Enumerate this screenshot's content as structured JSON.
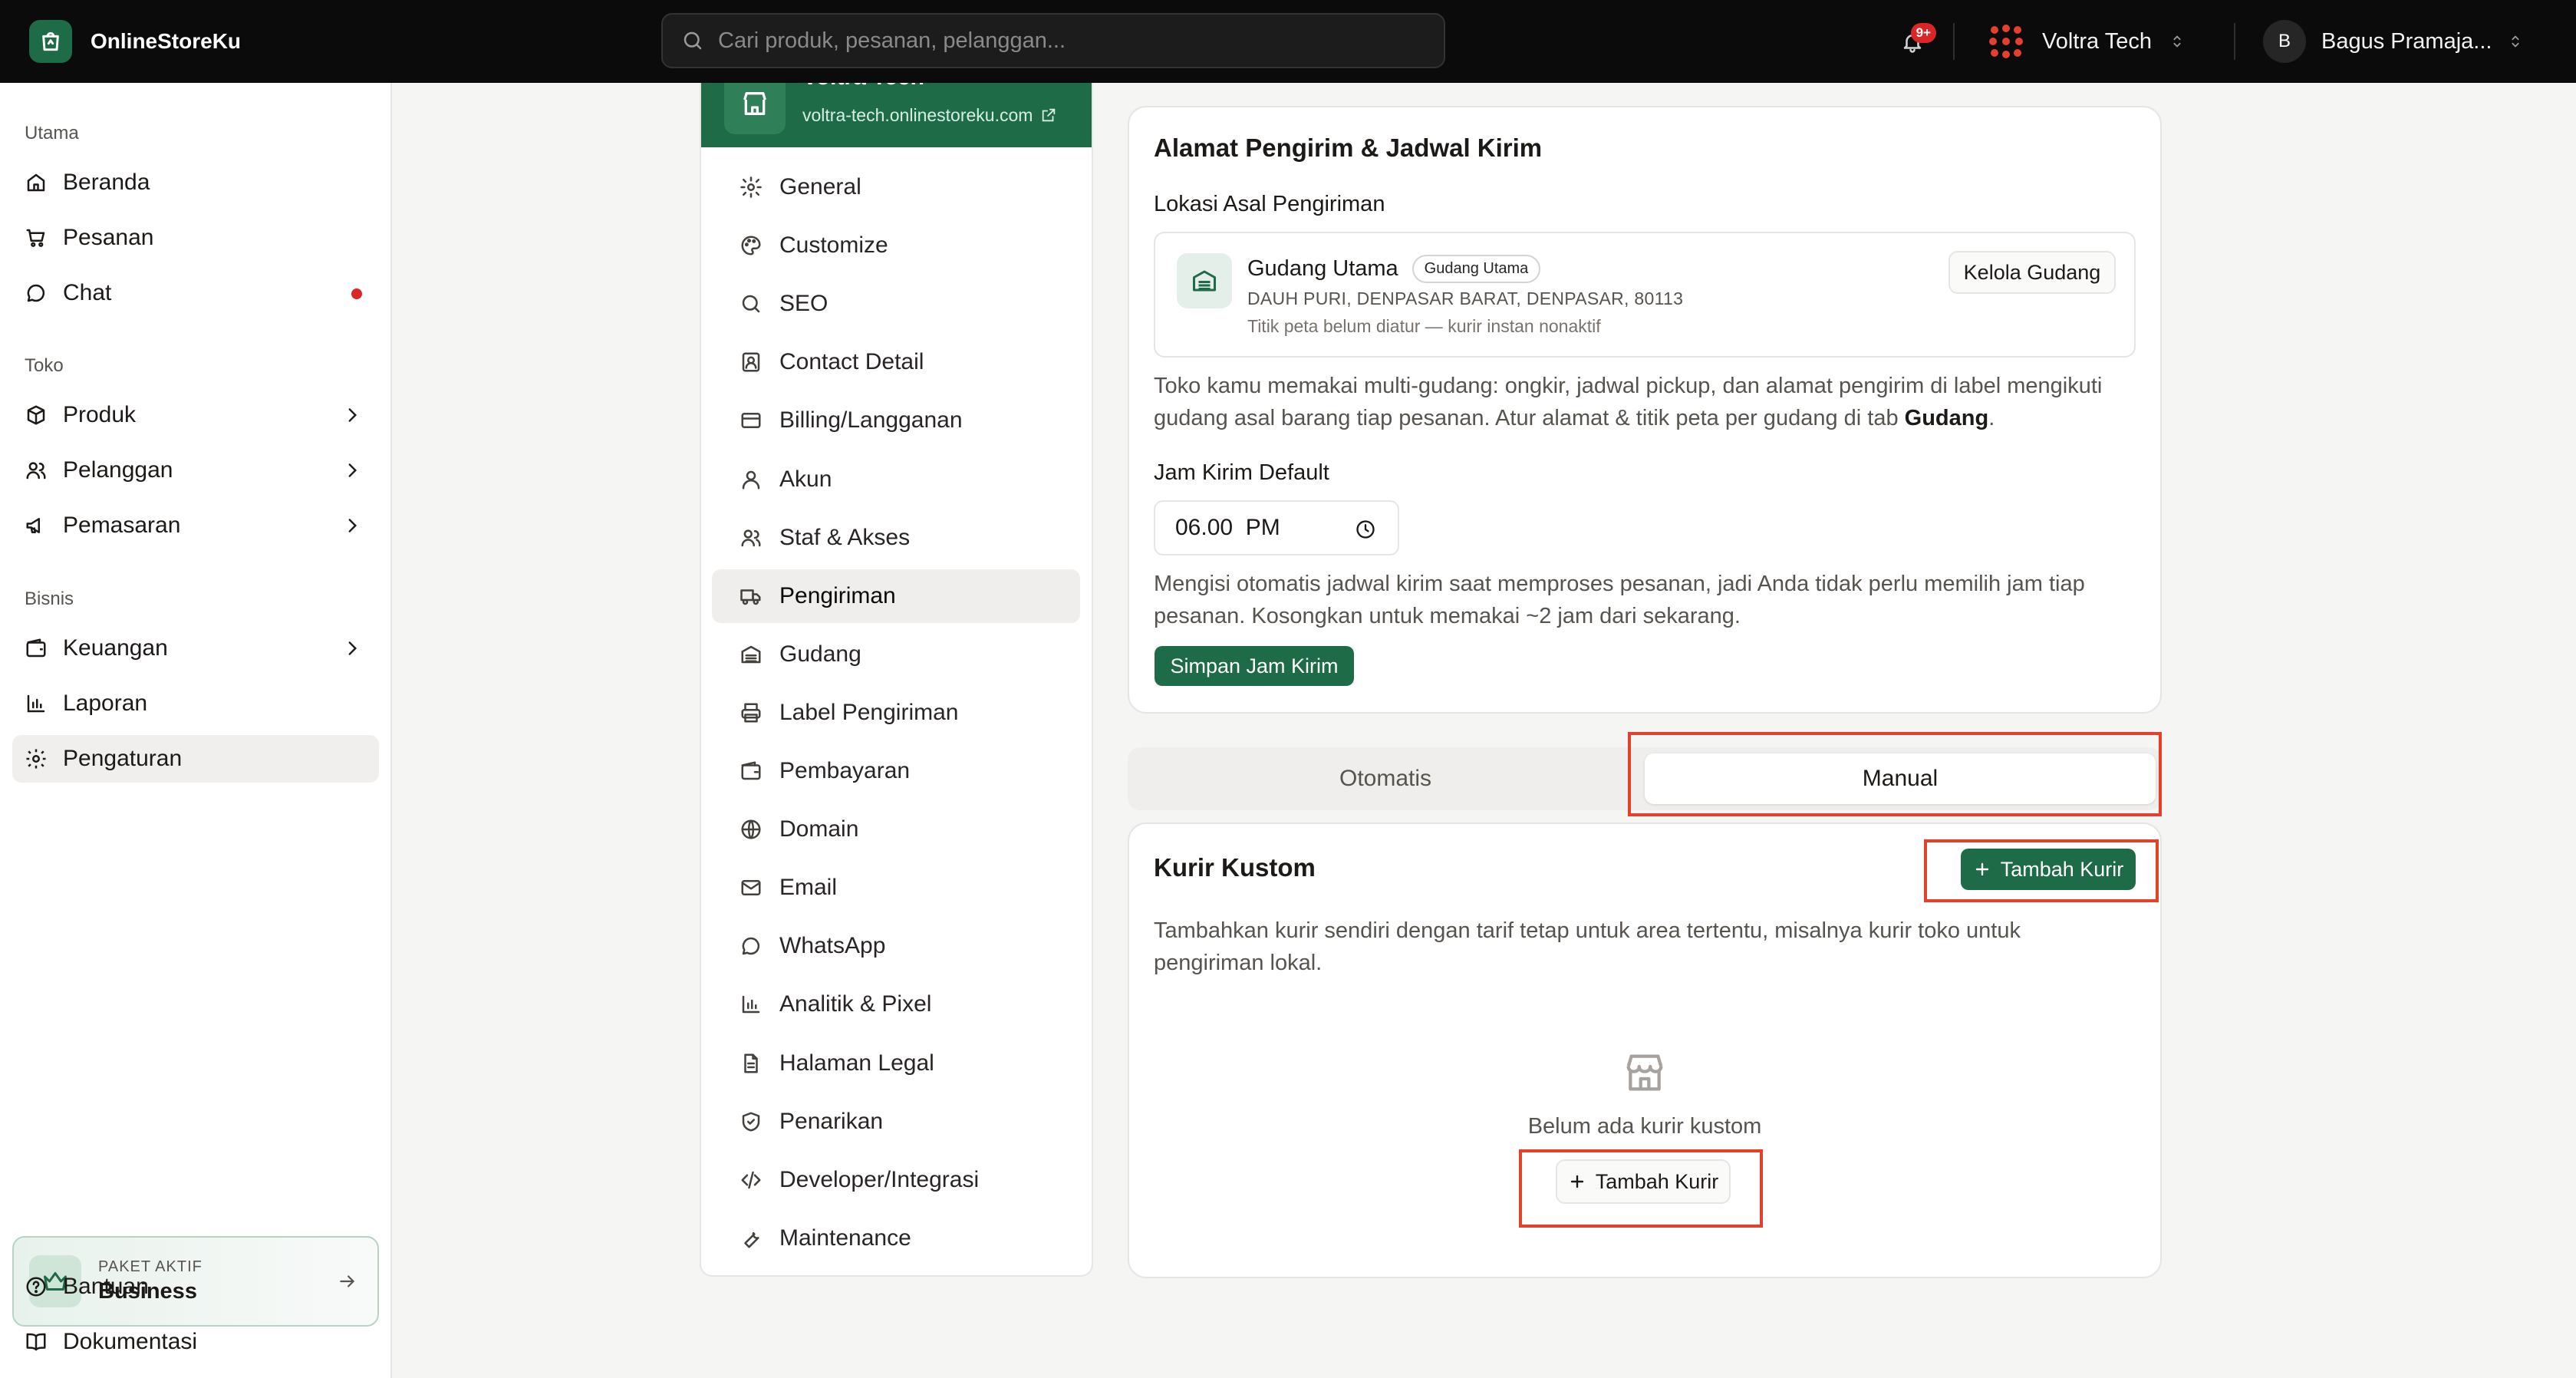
{
  "topbar": {
    "brand": "OnlineStoreKu",
    "search_placeholder": "Cari produk, pesanan, pelanggan...",
    "notification_badge": "9+",
    "store_name": "Voltra Tech",
    "avatar_initial": "B",
    "user_name": "Bagus Pramaja..."
  },
  "sidebar": {
    "groups": [
      {
        "label": "Utama",
        "items": [
          {
            "label": "Beranda",
            "icon": "home-icon"
          },
          {
            "label": "Pesanan",
            "icon": "cart-icon"
          },
          {
            "label": "Chat",
            "icon": "chat-icon",
            "dot": true
          }
        ]
      },
      {
        "label": "Toko",
        "items": [
          {
            "label": "Produk",
            "icon": "box-icon",
            "expandable": true
          },
          {
            "label": "Pelanggan",
            "icon": "users-icon",
            "expandable": true
          },
          {
            "label": "Pemasaran",
            "icon": "megaphone-icon",
            "expandable": true
          }
        ]
      },
      {
        "label": "Bisnis",
        "items": [
          {
            "label": "Keuangan",
            "icon": "wallet-icon",
            "expandable": true
          },
          {
            "label": "Laporan",
            "icon": "chart-icon"
          },
          {
            "label": "Pengaturan",
            "icon": "gear-icon",
            "active": true
          }
        ]
      }
    ],
    "plan": {
      "label": "PAKET AKTIF",
      "name": "Business"
    },
    "footer": [
      {
        "label": "Bantuan",
        "icon": "help-icon"
      },
      {
        "label": "Dokumentasi",
        "icon": "book-icon"
      }
    ]
  },
  "settings_menu": {
    "store_title": "Voltra Tech",
    "store_url": "voltra-tech.onlinestoreku.com",
    "items": [
      {
        "label": "General",
        "icon": "gear-icon"
      },
      {
        "label": "Customize",
        "icon": "palette-icon"
      },
      {
        "label": "SEO",
        "icon": "search-icon"
      },
      {
        "label": "Contact Detail",
        "icon": "contact-icon"
      },
      {
        "label": "Billing/Langganan",
        "icon": "credit-card-icon"
      },
      {
        "label": "Akun",
        "icon": "user-icon"
      },
      {
        "label": "Staf & Akses",
        "icon": "users-icon"
      },
      {
        "label": "Pengiriman",
        "icon": "truck-icon",
        "active": true
      },
      {
        "label": "Gudang",
        "icon": "warehouse-icon"
      },
      {
        "label": "Label Pengiriman",
        "icon": "printer-icon"
      },
      {
        "label": "Pembayaran",
        "icon": "wallet-icon"
      },
      {
        "label": "Domain",
        "icon": "globe-icon"
      },
      {
        "label": "Email",
        "icon": "mail-icon"
      },
      {
        "label": "WhatsApp",
        "icon": "whatsapp-icon"
      },
      {
        "label": "Analitik & Pixel",
        "icon": "bar-chart-icon"
      },
      {
        "label": "Halaman Legal",
        "icon": "document-icon"
      },
      {
        "label": "Penarikan",
        "icon": "shield-icon"
      },
      {
        "label": "Developer/Integrasi",
        "icon": "code-icon"
      },
      {
        "label": "Maintenance",
        "icon": "wrench-icon"
      }
    ]
  },
  "shipping": {
    "title": "Alamat Pengirim & Jadwal Kirim",
    "origin_label": "Lokasi Asal Pengiriman",
    "warehouse": {
      "name": "Gudang Utama",
      "badge": "Gudang Utama",
      "address": "DAUH PURI, DENPASAR BARAT, DENPASAR, 80113",
      "note": "Titik peta belum diatur — kurir instan nonaktif",
      "manage_button": "Kelola Gudang"
    },
    "multi_info_1": "Toko kamu memakai multi-gudang: ongkir, jadwal pickup, dan alamat pengirim di label mengikuti gudang asal barang tiap pesanan. Atur alamat & titik peta per gudang di tab ",
    "multi_info_bold": "Gudang",
    "multi_info_2": ".",
    "default_time_label": "Jam Kirim Default",
    "default_time_value": "06.00  PM",
    "time_help": "Mengisi otomatis jadwal kirim saat memproses pesanan, jadi Anda tidak perlu memilih jam tiap pesanan. Kosongkan untuk memakai ~2 jam dari sekarang.",
    "save_button": "Simpan Jam Kirim"
  },
  "courier_tabs": {
    "automatic": "Otomatis",
    "manual": "Manual",
    "selected": "Manual"
  },
  "custom_courier": {
    "title": "Kurir Kustom",
    "add_button": "Tambah Kurir",
    "description": "Tambahkan kurir sendiri dengan tarif tetap untuk area tertentu, misalnya kurir toko untuk pengiriman lokal.",
    "empty_text": "Belum ada kurir kustom",
    "empty_add_button": "Tambah Kurir"
  },
  "colors": {
    "brand_green": "#1e6b47",
    "highlight_red": "#e3412b",
    "notification_red": "#dc2626"
  }
}
